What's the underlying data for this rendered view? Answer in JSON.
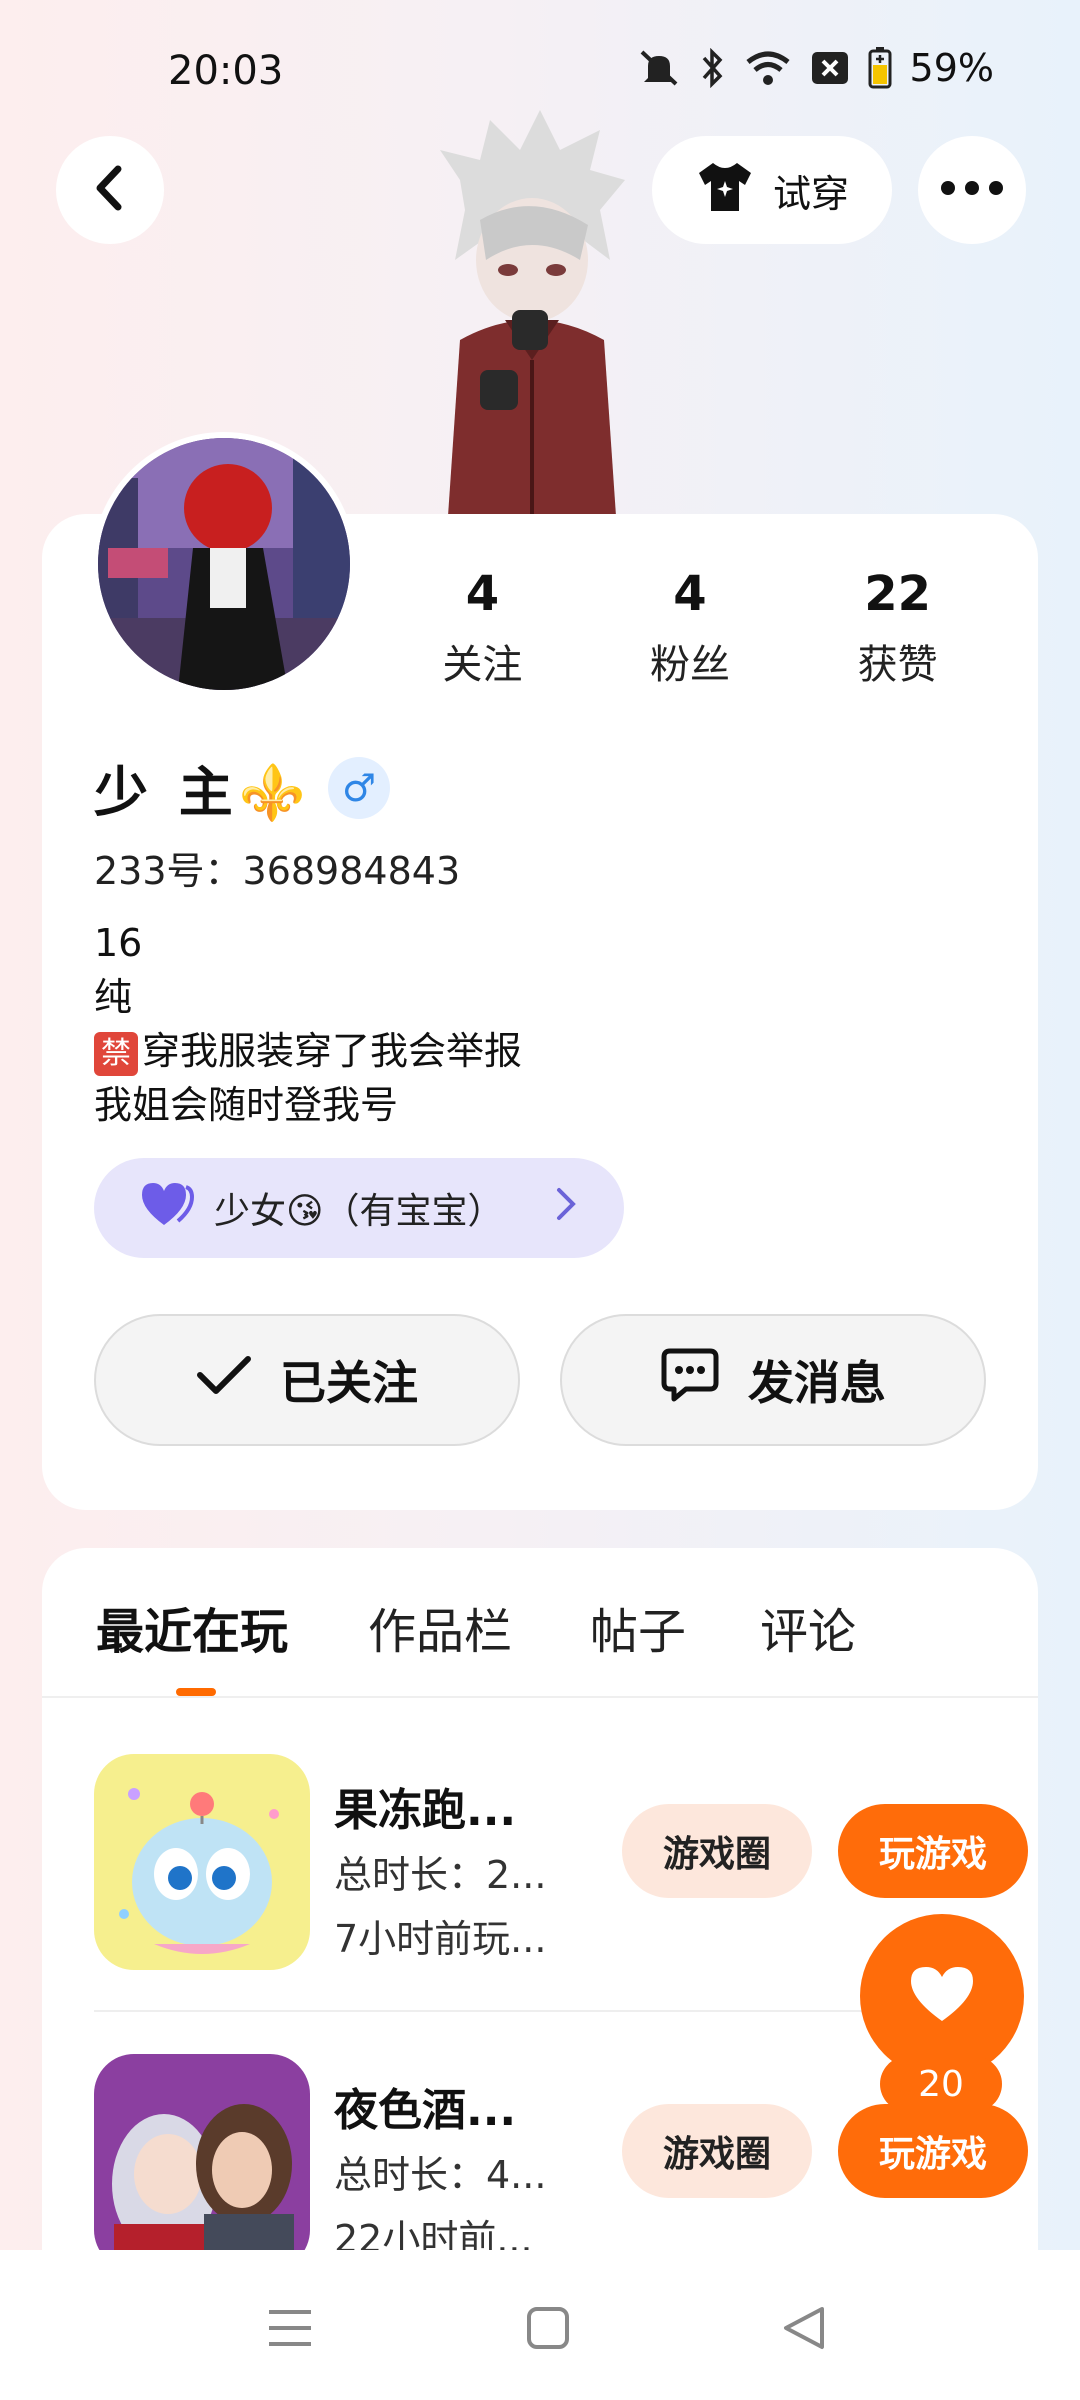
{
  "status_bar": {
    "time": "20:03",
    "battery_percent": "59%",
    "icons": [
      "mute-icon",
      "bluetooth-icon",
      "wifi-icon",
      "sim-off-icon",
      "battery-icon"
    ]
  },
  "header": {
    "try_on_label": "试穿",
    "back_icon": "back-icon",
    "more_icon": "more-icon"
  },
  "profile": {
    "stats": [
      {
        "value": "4",
        "label": "关注"
      },
      {
        "value": "4",
        "label": "粉丝"
      },
      {
        "value": "22",
        "label": "获赞"
      }
    ],
    "name": "少 主⚜️",
    "gender_symbol": "♂",
    "uid_line": "233号：368984843",
    "bio": {
      "line1": "16",
      "line2": "纯",
      "ban_mark": "禁",
      "line3": "穿我服装穿了我会举报",
      "line4": "我姐会随时登我号"
    },
    "tag": {
      "text": "少女😘（有宝宝）"
    },
    "follow_label": "已关注",
    "message_label": "发消息"
  },
  "tabs": [
    {
      "label": "最近在玩",
      "active": true
    },
    {
      "label": "作品栏",
      "active": false
    },
    {
      "label": "帖子",
      "active": false
    },
    {
      "label": "评论",
      "active": false
    }
  ],
  "games": [
    {
      "title": "果冻跑...",
      "duration": "总时长：2...",
      "last_played": "7小时前玩...",
      "circle_label": "游戏圈",
      "play_label": "玩游戏"
    },
    {
      "title": "夜色酒...",
      "duration": "总时长：4...",
      "last_played": "22小时前...",
      "circle_label": "游戏圈",
      "play_label": "玩游戏"
    }
  ],
  "like_fab": {
    "count": "20"
  },
  "colors": {
    "accent": "#ff6c0a",
    "tag_bg": "#e7e5fb",
    "gender_blue": "#2f86e6"
  }
}
